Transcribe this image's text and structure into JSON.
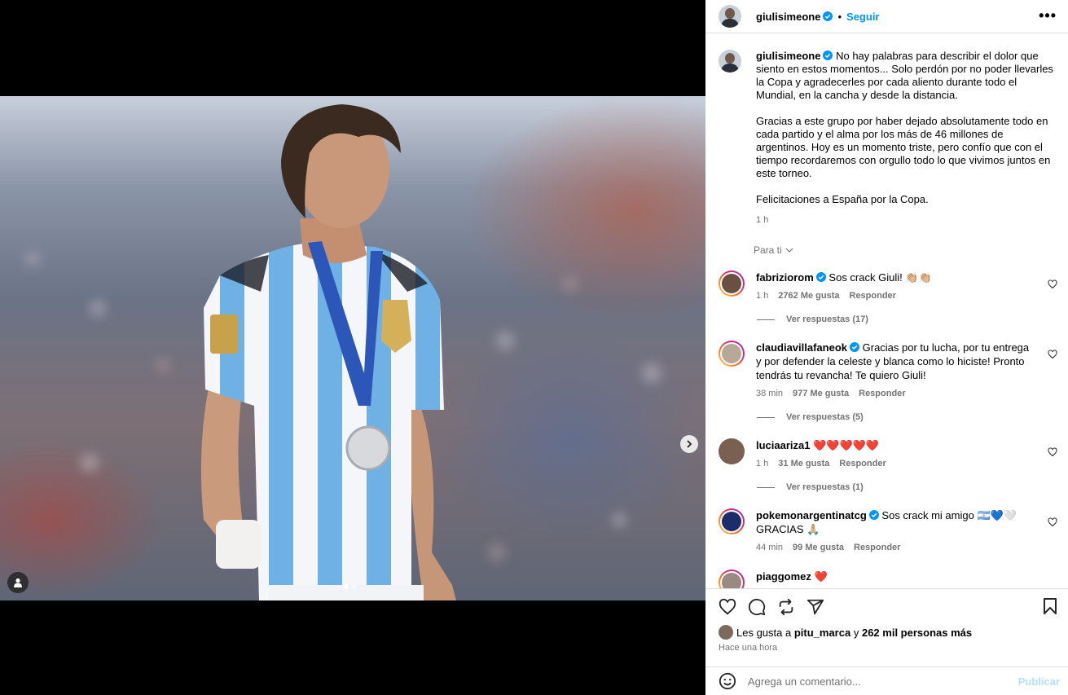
{
  "post": {
    "username": "giulisimeone",
    "follow_label": "Seguir",
    "more_label": "•••",
    "media_dots": 2
  },
  "caption": {
    "username": "giulisimeone",
    "p1": "No hay palabras para describir el dolor que siento en estos momentos... Solo perdón por no poder llevarles la Copa y agradecerles por cada aliento durante todo el Mundial, en la cancha y desde la distancia.",
    "p2": "Gracias a este grupo por haber dejado absolutamente todo en cada partido y el alma por los más de 46 millones de argentinos. Hoy es un momento triste, pero confío que con el tiempo recordaremos con orgullo todo lo que vivimos juntos en este torneo.",
    "p3": "Felicitaciones a España por la Copa.",
    "time": "1 h"
  },
  "sort_label": "Para ti",
  "comments": [
    {
      "user": "fabriziorom",
      "text": "Sos crack Giuli! 👏🏼👏🏼",
      "time": "1 h",
      "likes": "2762 Me gusta",
      "reply": "Responder",
      "replies": "Ver respuestas (17)"
    },
    {
      "user": "claudiavillafaneok",
      "text": "Gracias por tu lucha, por tu entrega y por defender la celeste y blanca como lo hiciste! Pronto tendrás tu revancha! Te quiero Giuli!",
      "time": "38 min",
      "likes": "977 Me gusta",
      "reply": "Responder",
      "replies": "Ver respuestas (5)"
    },
    {
      "user": "luciaariza1",
      "text": "❤️❤️❤️❤️❤️",
      "time": "1 h",
      "likes": "31 Me gusta",
      "reply": "Responder",
      "replies": "Ver respuestas (1)"
    },
    {
      "user": "pokemonargentinatcg",
      "text": "Sos crack mi amigo 🇦🇷💙🤍 GRACIAS 🙏🏼",
      "time": "44 min",
      "likes": "99 Me gusta",
      "reply": "Responder"
    },
    {
      "user": "piaggomez",
      "text": "❤️"
    }
  ],
  "likes": {
    "prefix": "Les gusta a",
    "user": "pitu_marca",
    "and": "y",
    "count": "262 mil personas más",
    "ago": "Hace una hora"
  },
  "composer": {
    "placeholder": "Agrega un comentario...",
    "publish": "Publicar"
  }
}
